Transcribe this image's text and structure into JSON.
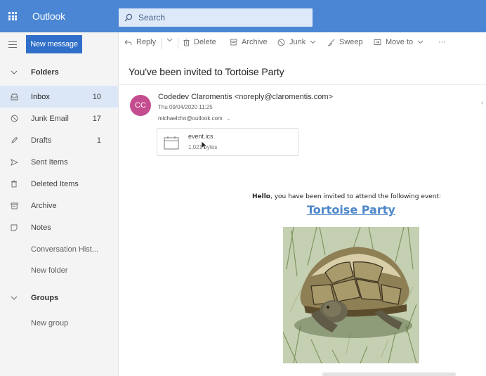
{
  "app": {
    "title": "Outlook"
  },
  "search": {
    "placeholder": "Search"
  },
  "leftnav": {
    "new_message_label": "New message",
    "folders_label": "Folders",
    "items": [
      {
        "label": "Inbox",
        "count": "10",
        "icon": "inbox-icon"
      },
      {
        "label": "Junk Email",
        "count": "17",
        "icon": "junk-icon"
      },
      {
        "label": "Drafts",
        "count": "1",
        "icon": "pencil-icon"
      },
      {
        "label": "Sent Items",
        "count": "",
        "icon": "send-icon"
      },
      {
        "label": "Deleted Items",
        "count": "",
        "icon": "trash-icon"
      },
      {
        "label": "Archive",
        "count": "",
        "icon": "archive-icon"
      },
      {
        "label": "Notes",
        "count": "",
        "icon": "note-icon"
      },
      {
        "label": "Conversation Hist...",
        "count": "",
        "icon": ""
      },
      {
        "label": "New folder",
        "count": "",
        "icon": ""
      }
    ],
    "groups_label": "Groups",
    "new_group_label": "New group"
  },
  "toolbar": {
    "reply": "Reply",
    "delete": "Delete",
    "archive": "Archive",
    "junk": "Junk",
    "sweep": "Sweep",
    "move_to": "Move to",
    "more": "···"
  },
  "message": {
    "subject": "You've been invited to Tortoise Party",
    "avatar_initials": "CC",
    "sender": "Codedev Claromentis <noreply@claromentis.com>",
    "date": "Thu 09/04/2020 11:25",
    "recipient": "michaelchn@outlook.com",
    "attachment": {
      "name": "event.ics",
      "size": "1,021 bytes"
    },
    "hello_bold": "Hello",
    "hello_rest": ", you have been invited to attend the following event:",
    "event_title": "Tortoise Party"
  },
  "colors": {
    "topbar": "#4a86d4",
    "new_message_button": "#2f6fc9",
    "avatar": "#c44d8f",
    "link": "#4f87c9",
    "active_folder": "#dbe7f6"
  }
}
